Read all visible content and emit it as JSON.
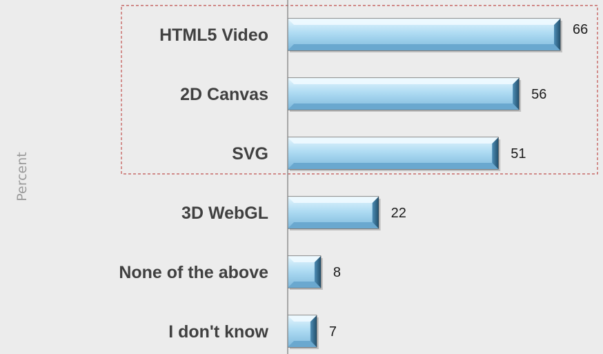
{
  "chart_data": {
    "type": "bar",
    "orientation": "horizontal",
    "categories": [
      "HTML5 Video",
      "2D Canvas",
      "SVG",
      "3D WebGL",
      "None of the above",
      "I don't know"
    ],
    "values": [
      66,
      56,
      51,
      22,
      8,
      7
    ],
    "ylabel": "Percent",
    "xlim": [
      0,
      75
    ],
    "grid": false,
    "highlight_group": [
      "HTML5 Video",
      "2D Canvas",
      "SVG"
    ],
    "colors": {
      "bar_light": "#d6effb",
      "bar_mid": "#a9d9f2",
      "bar_dark": "#5f9fc4",
      "bar_edge": "#3a3a3a",
      "highlight_border": "#c0504d",
      "axis": "#808080"
    }
  }
}
